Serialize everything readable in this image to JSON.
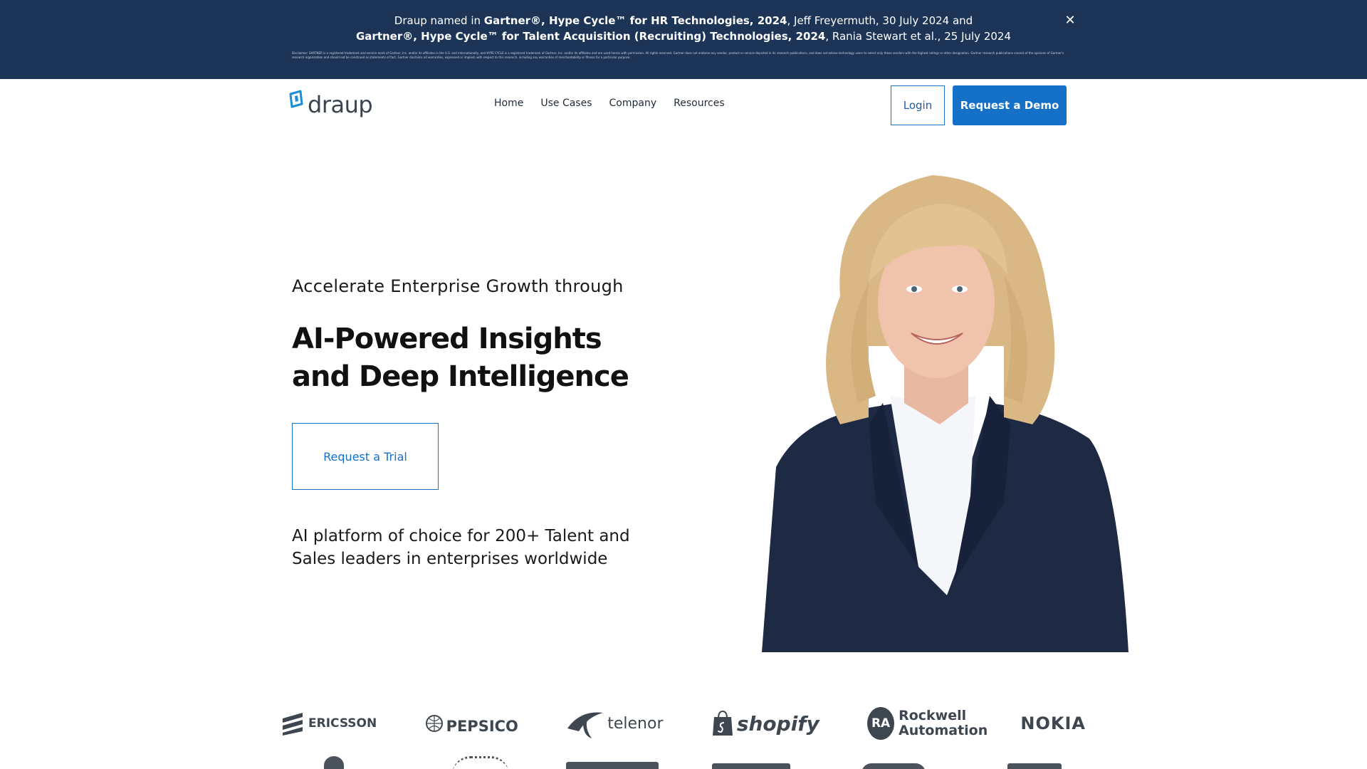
{
  "banner": {
    "line1_prefix": "Draup named in ",
    "line1_bold": "Gartner®, Hype Cycle™ for HR Technologies, 2024",
    "line1_suffix": ", Jeff Freyermuth, 30 July 2024 and",
    "line2_bold": "Gartner®, Hype Cycle™ for Talent Acquisition (Recruiting) Technologies, 2024",
    "line2_suffix": ", Rania Stewart et al., 25 July 2024",
    "disclaimer": "Disclaimer: GARTNER is a registered trademark and service mark of Gartner, Inc. and/or its affiliates in the U.S. and internationally, and HYPE CYCLE is a registered trademark of Gartner, Inc. and/or its affiliates and are used herein with permission. All rights reserved. Gartner does not endorse any vendor, product or service depicted in its research publications, and does not advise technology users to select only those vendors with the highest ratings or other designation. Gartner research publications consist of the opinions of Gartner's research organization and should not be construed as statements of fact. Gartner disclaims all warranties, expressed or implied, with respect to this research, including any warranties of merchantability or fitness for a particular purpose.",
    "close_symbol": "✕"
  },
  "nav": {
    "logo_text": "draup",
    "links": [
      "Home",
      "Use Cases",
      "Company",
      "Resources"
    ],
    "login_label": "Login",
    "demo_label": "Request a Demo"
  },
  "hero": {
    "subtitle": "Accelerate Enterprise Growth through",
    "title_line1": "AI-Powered Insights",
    "title_line2": "and Deep Intelligence",
    "trial_label": "Request a Trial",
    "description": "AI platform of choice for 200+ Talent and Sales leaders in enterprises worldwide"
  },
  "logos": {
    "row1": [
      "ERICSSON",
      "PEPSICO",
      "telenor",
      "shopify",
      "Rockwell Automation",
      "NOKIA"
    ],
    "rockwell_mark": "RA"
  },
  "colors": {
    "banner_bg": "#1c3557",
    "accent": "#1570c8",
    "logo_grey": "#3e4650"
  }
}
